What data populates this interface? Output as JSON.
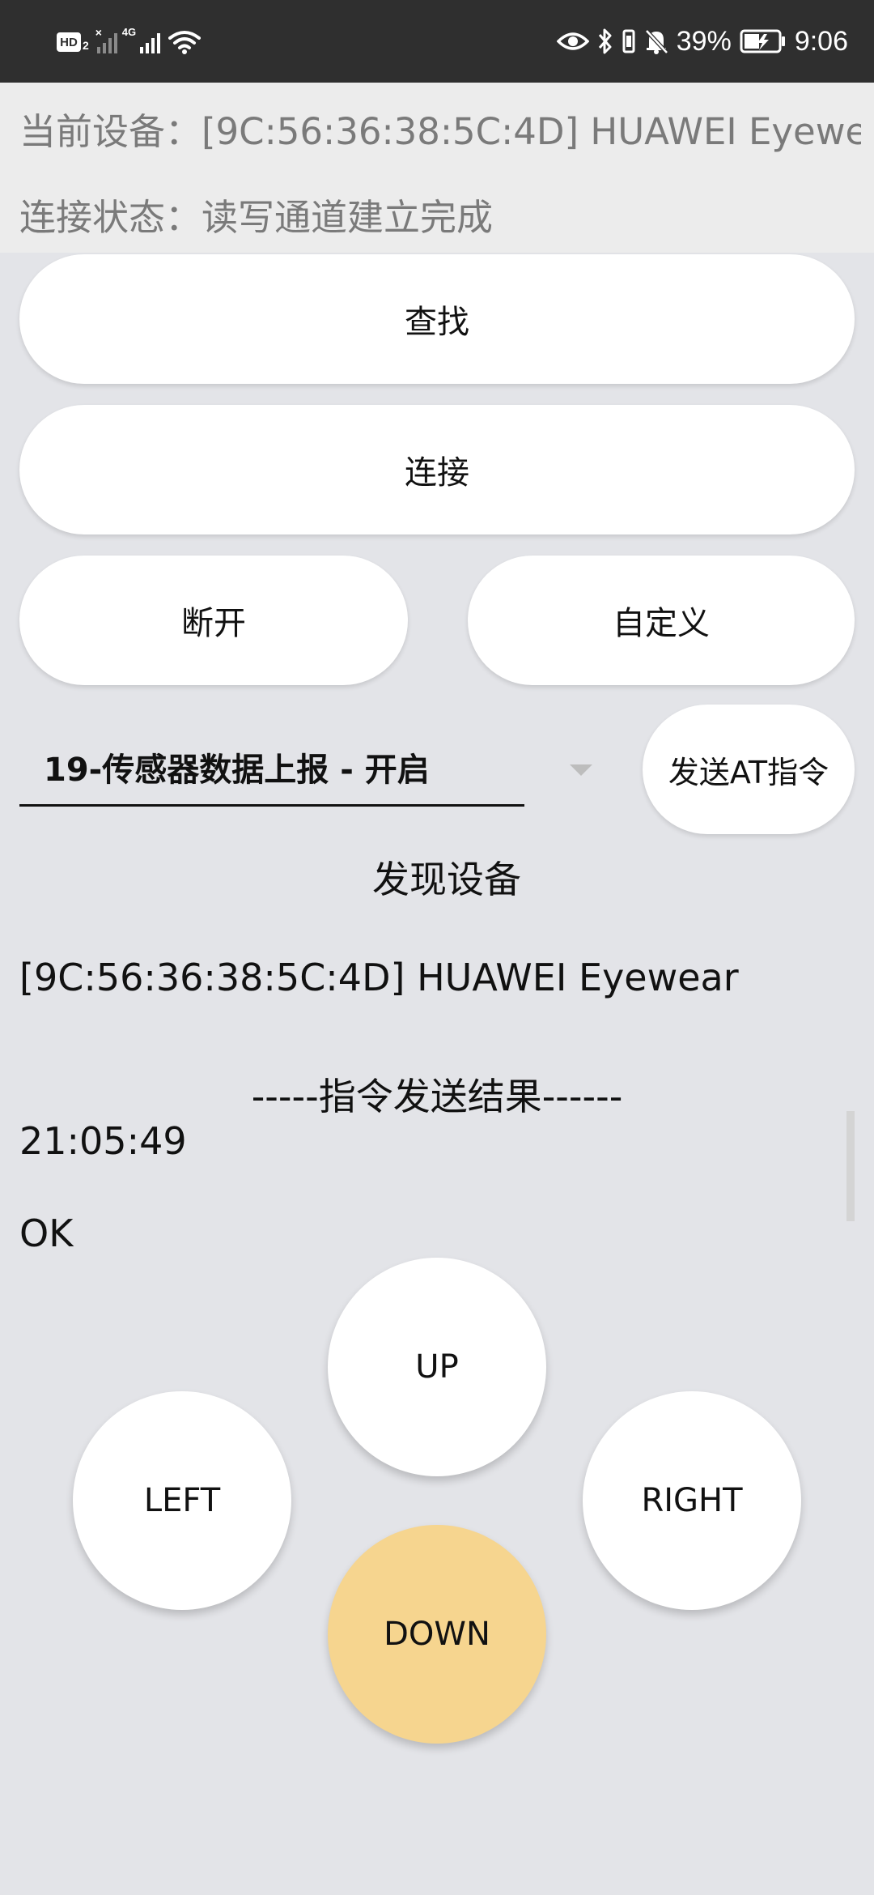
{
  "status_bar": {
    "hd_label": "HD",
    "hd_sub": "2",
    "network_label": "4G",
    "battery_percent": "39%",
    "time": "9:06",
    "icons": [
      "hd-icon",
      "signal-no-sim-icon",
      "signal-4g-icon",
      "wifi-icon",
      "eye-icon",
      "bluetooth-icon",
      "vibrate-icon",
      "mute-bell-icon",
      "battery-saver-icon"
    ]
  },
  "info": {
    "current_device": "当前设备：[9C:56:36:38:5C:4D] HUAWEI Eyewe..",
    "connection_status": "连接状态：读写通道建立完成"
  },
  "buttons": {
    "find": "查找",
    "connect": "连接",
    "disconnect": "断开",
    "custom": "自定义",
    "send_at": "发送AT指令"
  },
  "command_select": {
    "selected": "19-传感器数据上报 - 开启"
  },
  "discovered": {
    "title": "发现设备",
    "devices": [
      "[9C:56:36:38:5C:4D] HUAWEI Eyewear"
    ]
  },
  "result": {
    "title": "-----指令发送结果------",
    "time": "21:05:49",
    "response": "OK"
  },
  "dpad": {
    "up": "UP",
    "left": "LEFT",
    "right": "RIGHT",
    "down": "DOWN"
  },
  "colors": {
    "background": "#e3e4e8",
    "status_bar": "#2f2f2f",
    "info_panel": "#ececec",
    "active_button": "#f6d58f"
  }
}
